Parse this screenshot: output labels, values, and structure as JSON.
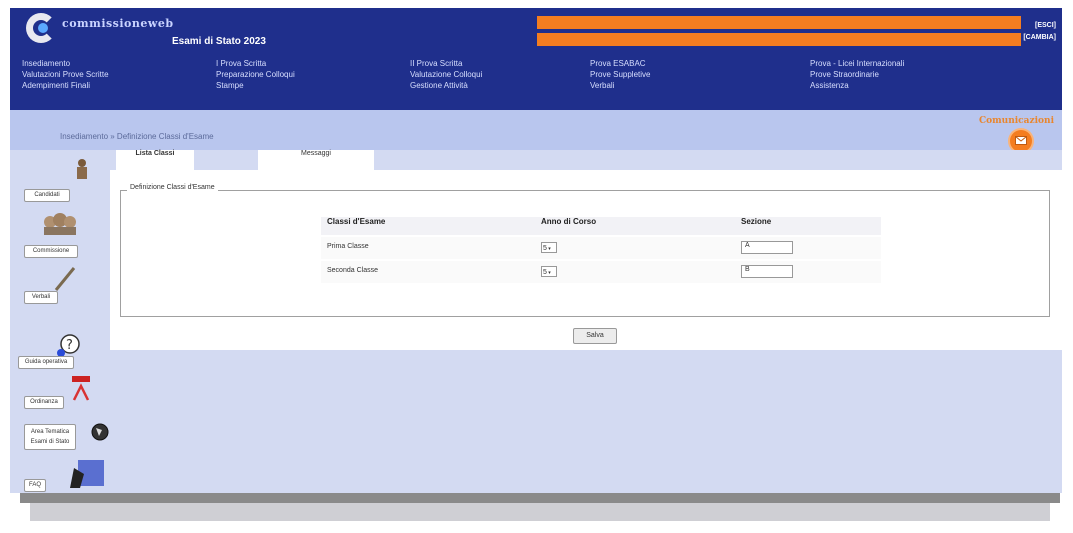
{
  "header": {
    "brand": "commissioneweb",
    "subtitle": "Esami di Stato 2023",
    "links": [
      "[ESCI]",
      "[CAMBIA]"
    ]
  },
  "menu": {
    "columns": [
      [
        "Insediamento",
        "Valutazioni Prove Scritte",
        "Adempimenti Finali"
      ],
      [
        "I Prova Scritta",
        "Preparazione Colloqui",
        "Stampe"
      ],
      [
        "II Prova Scritta",
        "Valutazione Colloqui",
        "Gestione Attività"
      ],
      [
        "Prova ESABAC",
        "Prove Suppletive",
        "Verbali"
      ],
      [
        "Prova - Licei Internazionali",
        "Prove Straordinarie",
        "Assistenza"
      ]
    ]
  },
  "breadcrumb": "Insediamento » Definizione Classi d'Esame",
  "comunicazioni_label": "Comunicazioni",
  "tabs": [
    "Lista Classi",
    "Messaggi"
  ],
  "fieldset_legend": "Definizione Classi d'Esame",
  "table": {
    "headers": [
      "Classi d'Esame",
      "Anno di Corso",
      "Sezione"
    ],
    "rows": [
      {
        "name": "Prima Classe",
        "anno": "5",
        "sezione": "A"
      },
      {
        "name": "Seconda Classe",
        "anno": "5",
        "sezione": "B"
      }
    ]
  },
  "save_label": "Salva",
  "sidebar": [
    "Candidati",
    "Commissione",
    "Verbali",
    "Guida operativa",
    "Ordinanza",
    "Area Tematica Esami di Stato",
    "FAQ"
  ],
  "icons": [
    "envelope-icon",
    "chevron-down-icon"
  ]
}
